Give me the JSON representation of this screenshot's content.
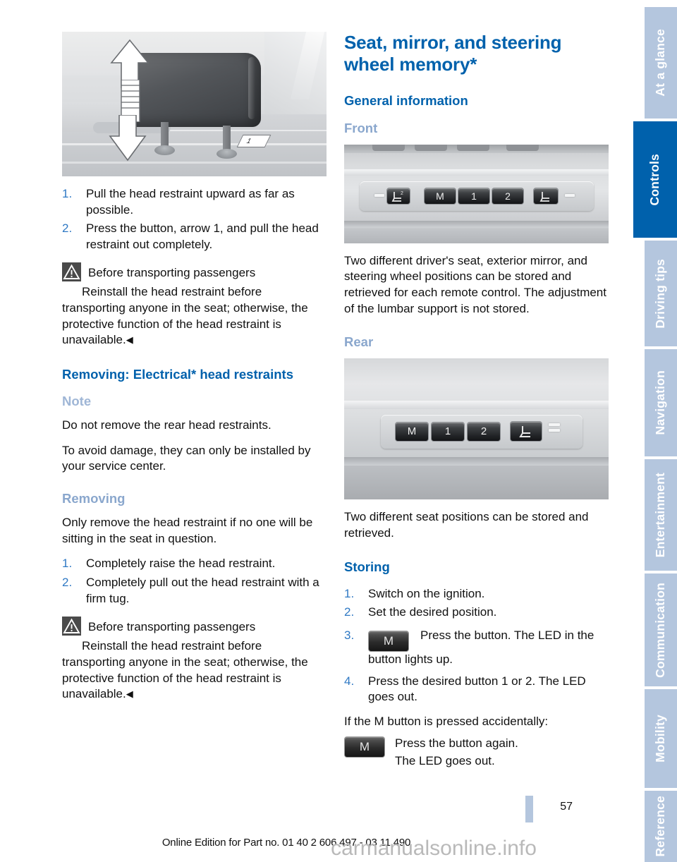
{
  "document": {
    "page_number": "57",
    "footer_note": "Online Edition for Part no. 01 40 2 606 497 - 03 11 490",
    "watermark": "carmanualsonline.info"
  },
  "colors": {
    "heading_blue": "#0061ac",
    "subheading_blue_gray": "#8aa7cd",
    "tab_inactive": "#b4c6de",
    "tab_active": "#0061ac",
    "list_number": "#2f79c4"
  },
  "sidebar": {
    "tabs": [
      {
        "label": "At a glance",
        "active": false
      },
      {
        "label": "Controls",
        "active": true
      },
      {
        "label": "Driving tips",
        "active": false
      },
      {
        "label": "Navigation",
        "active": false
      },
      {
        "label": "Entertainment",
        "active": false
      },
      {
        "label": "Communication",
        "active": false
      },
      {
        "label": "Mobility",
        "active": false
      },
      {
        "label": "Reference",
        "active": false
      }
    ]
  },
  "left_column": {
    "figure_caption": "Head restraint adjustment with up/down arrows and release button arrow 1",
    "steps_top": [
      {
        "num": "1.",
        "text": "Pull the head restraint upward as far as possible."
      },
      {
        "num": "2.",
        "text": "Press the button, arrow 1, and pull the head restraint out completely."
      }
    ],
    "warning_1": {
      "headline": "Before transporting passengers",
      "text": "Reinstall the head restraint before transporting anyone in the seat; otherwise, the protective function of the head restraint is unavailable.",
      "endmark": "◀"
    },
    "section_heading": "Removing: Electrical* head restraints",
    "note_heading": "Note",
    "note_paragraphs": [
      "Do not remove the rear head restraints.",
      "To avoid damage, they can only be installed by your service center."
    ],
    "removing_heading": "Removing",
    "removing_intro": "Only remove the head restraint if no one will be sitting in the seat in question.",
    "removing_steps": [
      {
        "num": "1.",
        "text": "Completely raise the head restraint."
      },
      {
        "num": "2.",
        "text": "Completely pull out the head restraint with a firm tug."
      }
    ],
    "warning_2": {
      "headline": "Before transporting passengers",
      "text": "Reinstall the head restraint before transporting anyone in the seat; otherwise, the protective function of the head restraint is unavailable.",
      "endmark": "◀"
    }
  },
  "right_column": {
    "title": "Seat, mirror, and steering wheel memory*",
    "general_heading": "General information",
    "front_heading": "Front",
    "front_figure": {
      "caption": "Front door memory button panel",
      "buttons": [
        "seat-2-icon",
        "M",
        "1",
        "2",
        "seat-icon"
      ]
    },
    "front_paragraph": "Two different driver's seat, exterior mirror, and steering wheel positions can be stored and retrieved for each remote control. The adjustment of the lumbar support is not stored.",
    "rear_heading": "Rear",
    "rear_figure": {
      "caption": "Rear door memory button panel",
      "buttons": [
        "M",
        "1",
        "2",
        "seat-icon"
      ]
    },
    "rear_paragraph": "Two different seat positions can be stored and retrieved.",
    "storing_heading": "Storing",
    "storing_steps": [
      {
        "num": "1.",
        "text": "Switch on the ignition.",
        "button": null
      },
      {
        "num": "2.",
        "text": "Set the desired position.",
        "button": null
      },
      {
        "num": "3.",
        "text": "Press the button. The LED in the button lights up.",
        "button": "M"
      },
      {
        "num": "4.",
        "text": "Press the desired button 1 or 2. The LED goes out.",
        "button": null
      }
    ],
    "accidental_intro": "If the M button is pressed accidentally:",
    "accidental_button": "M",
    "accidental_lines": [
      "Press the button again.",
      "The LED goes out."
    ]
  }
}
